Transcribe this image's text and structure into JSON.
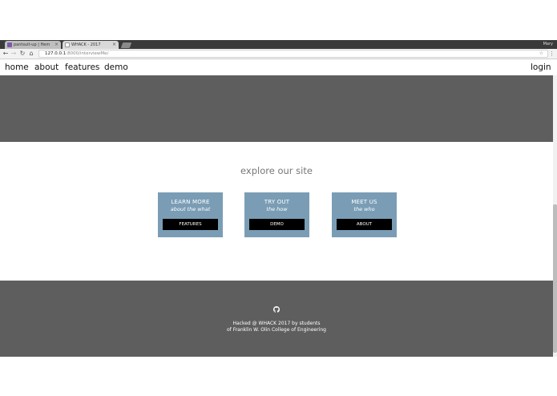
{
  "browser": {
    "tabs": [
      {
        "label": "pantsuit-up | Hem",
        "favicon_color": "#7b5aa6"
      },
      {
        "label": "WHACK - 2017",
        "favicon_color": "#ffffff"
      }
    ],
    "user": "Mary",
    "url_host": "127.0.0.1",
    "url_rest": ":8000/interviewMe/"
  },
  "nav": {
    "links": [
      "home",
      "about",
      "features",
      "demo"
    ],
    "login": "login"
  },
  "explore": {
    "title": "explore our site",
    "cards": [
      {
        "title": "LEARN MORE",
        "subtitle": "about the what",
        "button": "FEATURES"
      },
      {
        "title": "TRY OUT",
        "subtitle": "the how",
        "button": "DEMO"
      },
      {
        "title": "MEET US",
        "subtitle": "the who",
        "button": "ABOUT"
      }
    ],
    "card_color": "#7a9db5"
  },
  "footer": {
    "icon": "github-icon",
    "line1": "Hacked @ WHACK 2017 by students",
    "line2": "of Franklin W. Olin College of Engineering"
  }
}
